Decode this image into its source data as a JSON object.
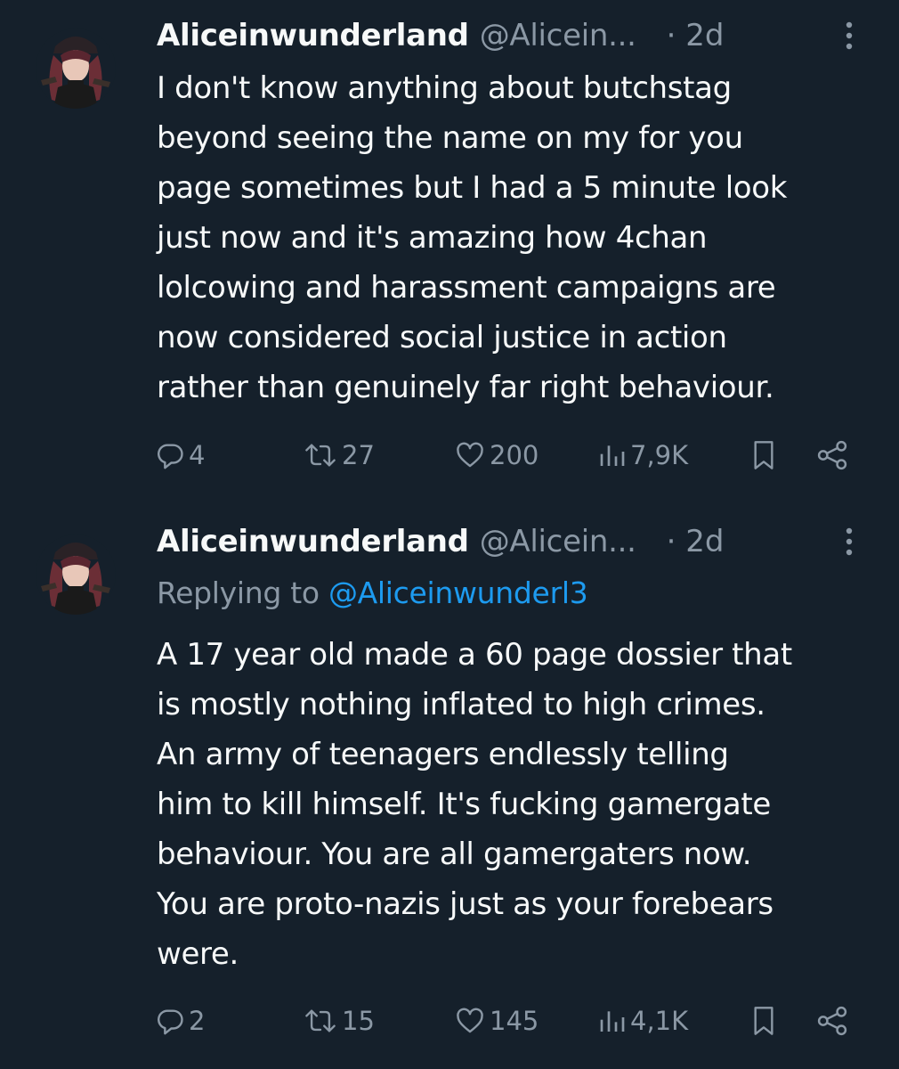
{
  "tweets": [
    {
      "display_name": "Aliceinwunderland",
      "handle": "@Alicein...",
      "time": "· 2d",
      "text_lines": [
        "I don't know anything about butchstag",
        "beyond seeing the name on my for you",
        "page sometimes but I had a 5 minute look",
        "just now and it's amazing how 4chan",
        "lolcowing and harassment campaigns are",
        "now considered social justice in action",
        "rather than genuinely far right behaviour."
      ],
      "actions": {
        "replies": "4",
        "reposts": "27",
        "likes": "200",
        "views": "7,9K"
      }
    },
    {
      "display_name": "Aliceinwunderland",
      "handle": "@Alicein...",
      "time": "· 2d",
      "replying_prefix": "Replying to",
      "replying_to": "@Aliceinwunderl3",
      "text_lines": [
        "A 17 year old made a 60 page dossier that",
        "is mostly nothing inflated to high crimes.",
        "An army of teenagers endlessly telling",
        "him to kill himself. It's fucking gamergate",
        "behaviour. You are all gamergaters now.",
        "You are proto-nazis just as your forebears",
        "were."
      ],
      "actions": {
        "replies": "2",
        "reposts": "15",
        "likes": "145",
        "views": "4,1K"
      }
    }
  ],
  "icons": {
    "reply": "reply-icon",
    "repost": "repost-icon",
    "like": "heart-icon",
    "views": "views-icon",
    "bookmark": "bookmark-icon",
    "share": "share-icon",
    "more": "more-vertical-icon"
  },
  "colors": {
    "background": "#15202b",
    "text": "#f7f9f9",
    "secondary": "#8b98a5",
    "accent": "#1d9bf0"
  }
}
